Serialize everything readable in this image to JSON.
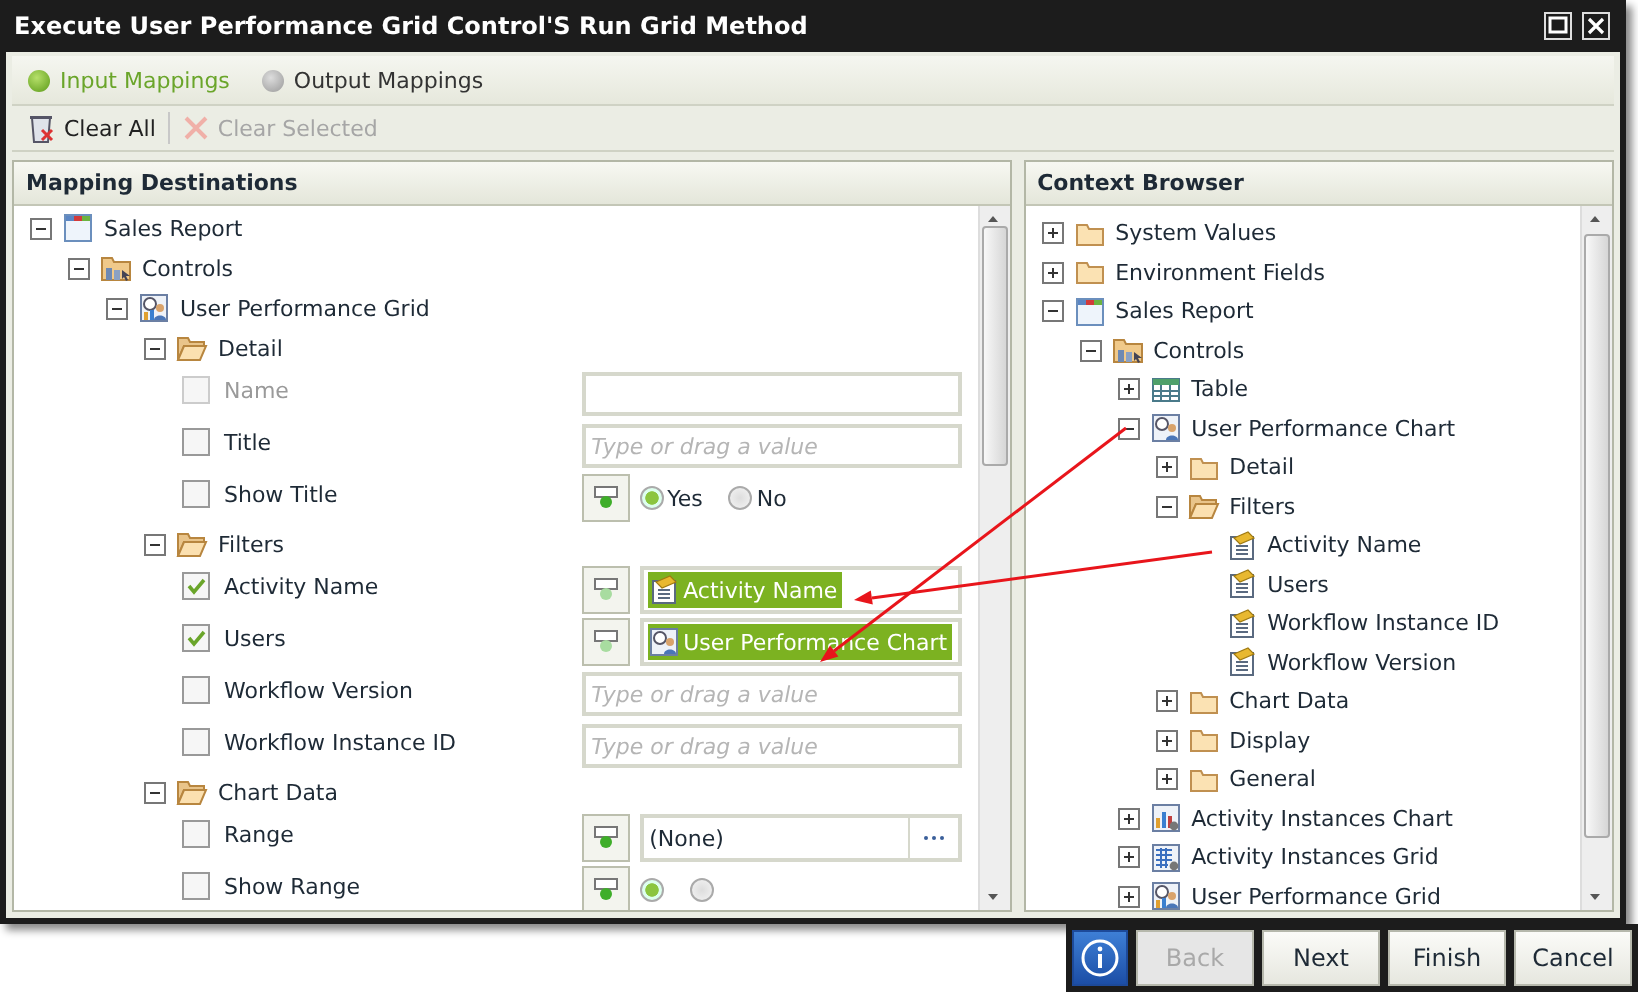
{
  "window": {
    "title": "Execute User Performance Grid Control'S Run Grid Method"
  },
  "tabs": [
    {
      "label": "Input Mappings",
      "selected": true
    },
    {
      "label": "Output Mappings",
      "selected": false
    }
  ],
  "toolbar": [
    {
      "label": "Clear All",
      "kind": "clear-all",
      "disabled": false
    },
    {
      "label": "Clear Selected",
      "kind": "clear-selected",
      "disabled": true
    }
  ],
  "mapping_destinations": {
    "title": "Mapping Destinations",
    "tree": [
      {
        "label": "Sales Report",
        "kind": "report",
        "expanded": true,
        "children": [
          {
            "label": "Controls",
            "kind": "controls",
            "expanded": true,
            "children": [
              {
                "label": "User Performance Grid",
                "kind": "grid",
                "expanded": true,
                "children": [
                  {
                    "label": "Detail",
                    "kind": "folder",
                    "expanded": true,
                    "children": [
                      {
                        "label": "Name",
                        "kind": "field",
                        "checked": false,
                        "disabled": true,
                        "control": {
                          "kind": "text"
                        }
                      },
                      {
                        "label": "Title",
                        "kind": "field",
                        "checked": false,
                        "disabled": false,
                        "control": {
                          "kind": "text",
                          "placeholder": "Type or drag a value"
                        }
                      },
                      {
                        "label": "Show Title",
                        "kind": "field",
                        "checked": false,
                        "disabled": false,
                        "control": {
                          "kind": "radio",
                          "options": [
                            {
                              "label": "Yes",
                              "selected": true
                            },
                            {
                              "label": "No",
                              "selected": false
                            }
                          ]
                        }
                      }
                    ]
                  },
                  {
                    "label": "Filters",
                    "kind": "folder",
                    "expanded": true,
                    "children": [
                      {
                        "label": "Activity Name",
                        "kind": "field",
                        "checked": true,
                        "disabled": false,
                        "control": {
                          "kind": "token",
                          "token": {
                            "kind": "property",
                            "value": "Activity Name"
                          }
                        }
                      },
                      {
                        "label": "Users",
                        "kind": "field",
                        "checked": true,
                        "disabled": false,
                        "control": {
                          "kind": "token",
                          "token": {
                            "kind": "chart",
                            "value": "User Performance Chart"
                          }
                        }
                      },
                      {
                        "label": "Workflow Version",
                        "kind": "field",
                        "checked": false,
                        "disabled": false,
                        "control": {
                          "kind": "text",
                          "placeholder": "Type or drag a value"
                        }
                      },
                      {
                        "label": "Workflow Instance ID",
                        "kind": "field",
                        "checked": false,
                        "disabled": false,
                        "control": {
                          "kind": "text",
                          "placeholder": "Type or drag a value"
                        }
                      }
                    ]
                  },
                  {
                    "label": "Chart Data",
                    "kind": "folder",
                    "expanded": true,
                    "children": [
                      {
                        "label": "Range",
                        "kind": "field",
                        "checked": false,
                        "disabled": false,
                        "control": {
                          "kind": "select",
                          "value": "(None)"
                        }
                      },
                      {
                        "label": "Show Range",
                        "kind": "field",
                        "checked": false,
                        "disabled": false,
                        "control": {
                          "kind": "radio",
                          "options": [
                            {
                              "selected": true
                            },
                            {
                              "selected": false
                            }
                          ]
                        }
                      }
                    ]
                  }
                ]
              }
            ]
          }
        ]
      }
    ]
  },
  "context_browser": {
    "title": "Context Browser",
    "tree": [
      {
        "label": "System Values",
        "kind": "folder",
        "expanded": false
      },
      {
        "label": "Environment Fields",
        "kind": "folder",
        "expanded": false
      },
      {
        "label": "Sales Report",
        "kind": "report",
        "expanded": true,
        "children": [
          {
            "label": "Controls",
            "kind": "controls",
            "expanded": true,
            "children": [
              {
                "label": "Table",
                "kind": "table",
                "expanded": false
              },
              {
                "label": "User Performance Chart",
                "kind": "chart",
                "expanded": true,
                "children": [
                  {
                    "label": "Detail",
                    "kind": "folder",
                    "expanded": false
                  },
                  {
                    "label": "Filters",
                    "kind": "folder",
                    "expanded": true,
                    "children": [
                      {
                        "label": "Activity Name",
                        "kind": "property"
                      },
                      {
                        "label": "Users",
                        "kind": "property"
                      },
                      {
                        "label": "Workflow Instance ID",
                        "kind": "property"
                      },
                      {
                        "label": "Workflow Version",
                        "kind": "property"
                      }
                    ]
                  },
                  {
                    "label": "Chart Data",
                    "kind": "folder",
                    "expanded": false
                  },
                  {
                    "label": "Display",
                    "kind": "folder",
                    "expanded": false
                  },
                  {
                    "label": "General",
                    "kind": "folder",
                    "expanded": false
                  }
                ]
              },
              {
                "label": "Activity Instances Chart",
                "kind": "bar-chart",
                "expanded": false
              },
              {
                "label": "Activity Instances Grid",
                "kind": "grid-control",
                "expanded": false
              },
              {
                "label": "User Performance Grid",
                "kind": "grid",
                "expanded": false
              }
            ]
          }
        ]
      }
    ]
  },
  "buttons": [
    {
      "label": "Back",
      "disabled": true
    },
    {
      "label": "Next",
      "disabled": false
    },
    {
      "label": "Finish",
      "disabled": false
    },
    {
      "label": "Cancel",
      "disabled": false
    }
  ]
}
